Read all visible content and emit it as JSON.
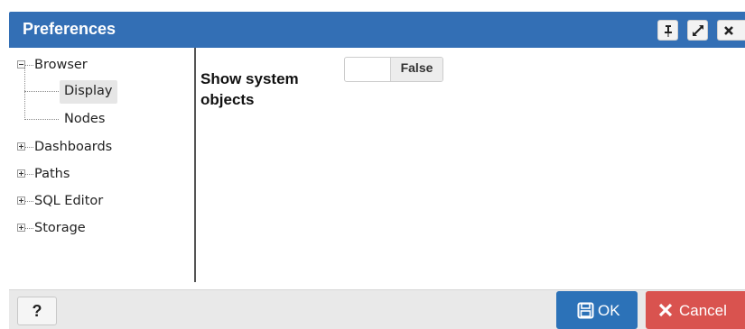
{
  "dialog": {
    "title": "Preferences"
  },
  "titlebar": {
    "buttons": [
      {
        "name": "pin-icon"
      },
      {
        "name": "maximize-icon"
      },
      {
        "name": "close-icon"
      }
    ]
  },
  "tree": {
    "items": [
      {
        "label": "Browser",
        "expanded": true
      },
      {
        "label": "Display",
        "selected": true
      },
      {
        "label": "Nodes"
      },
      {
        "label": "Dashboards",
        "expanded": false
      },
      {
        "label": "Paths",
        "expanded": false
      },
      {
        "label": "SQL Editor",
        "expanded": false
      },
      {
        "label": "Storage",
        "expanded": false
      }
    ]
  },
  "content": {
    "field_label": "Show system objects",
    "toggle_value": "False"
  },
  "footer": {
    "help_label": "?",
    "ok_label": "OK",
    "cancel_label": "Cancel"
  },
  "colors": {
    "titlebar": "#336fb5",
    "ok_button": "#2c72b8",
    "cancel_button": "#d9534f",
    "footer": "#e9e9e9"
  }
}
